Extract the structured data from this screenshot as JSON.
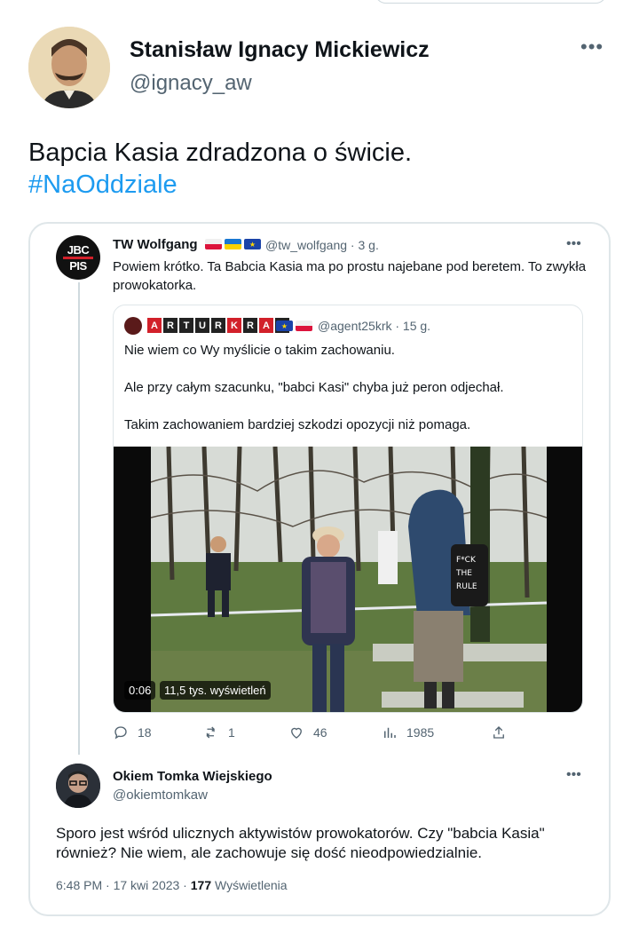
{
  "tweet": {
    "author_name": "Stanisław Ignacy Mickiewicz",
    "author_handle": "@ignacy_aw",
    "text": "Bapcia Kasia zdradzona o świcie.",
    "hashtag": "#NaOddziale",
    "more_icon": "more-horizontal-icon"
  },
  "embedded": {
    "reply_tweet": {
      "avatar_text_1": "JBC",
      "avatar_text_2": "PIS",
      "author_name": "TW Wolfgang",
      "handle_time": "@tw_wolfgang · 3 g.",
      "text": "Powiem krótko. Ta Babcia Kasia ma po prostu najebane pod beretem. To zwykła prowokatorka."
    },
    "quoted_tweet": {
      "name_letters": [
        "A",
        "R",
        "T",
        "U",
        "R",
        "K",
        "R",
        "A",
        "K"
      ],
      "handle_time": "@agent25krk · 15 g.",
      "paragraph_1": "Nie wiem co Wy myślicie o takim zachowaniu.",
      "paragraph_2": "Ale przy całym szacunku, \"babci Kasi\" chyba już peron odjechał.",
      "paragraph_3": "Takim zachowaniem bardziej szkodzi opozycji niż pomaga.",
      "video": {
        "time": "0:06",
        "views": "11,5 tys. wyświetleń",
        "sign_text": "F*CK THE RULE"
      }
    },
    "actions": {
      "replies": "18",
      "retweets": "1",
      "likes": "46",
      "views": "1985"
    },
    "final_tweet": {
      "author_name": "Okiem Tomka Wiejskiego",
      "handle": "@okiemtomkaw",
      "text": "Sporo jest wśród ulicznych aktywistów prowokatorów. Czy \"babcia Kasia\" również? Nie wiem, ale zachowuje się dość nieodpowiedzialnie.",
      "timestamp": "6:48 PM · 17 kwi 2023 · ",
      "view_count": "177",
      "view_label": " Wyświetlenia"
    }
  },
  "colors": {
    "text": "#0f1419",
    "muted": "#536471",
    "link": "#1d9bf0",
    "border": "#dfe6e9"
  }
}
